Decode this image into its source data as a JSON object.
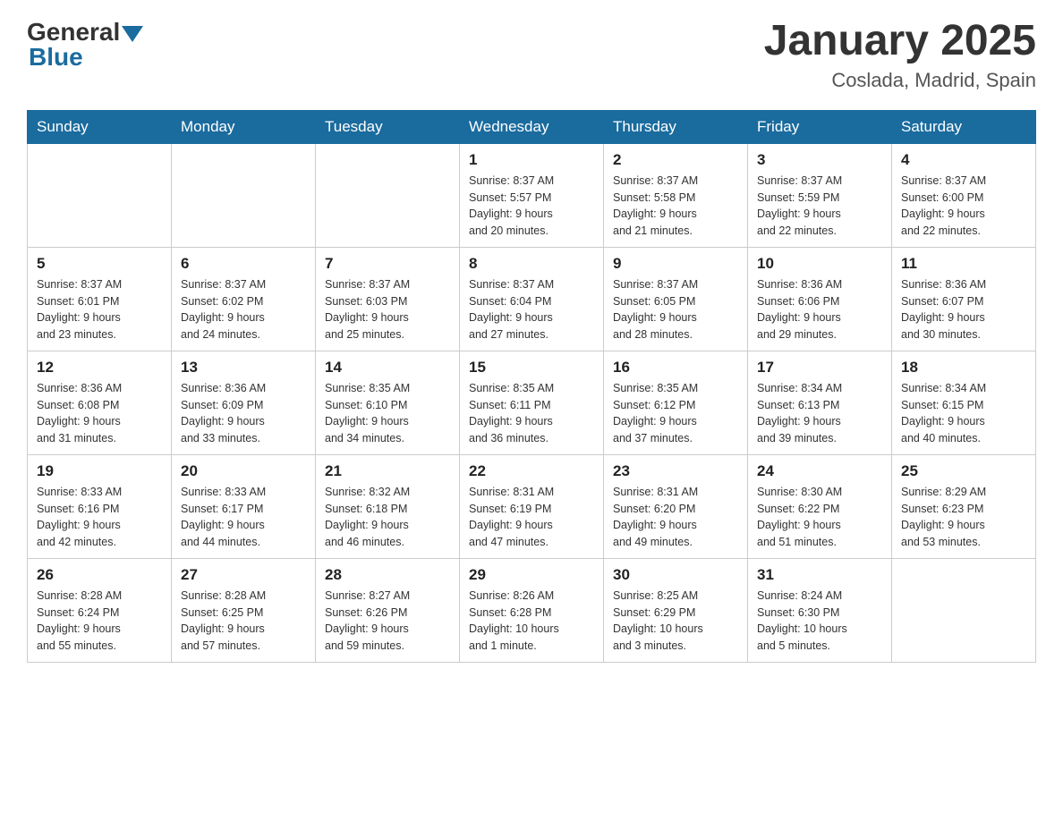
{
  "header": {
    "logo_general": "General",
    "logo_blue": "Blue",
    "month_title": "January 2025",
    "subtitle": "Coslada, Madrid, Spain"
  },
  "days_of_week": [
    "Sunday",
    "Monday",
    "Tuesday",
    "Wednesday",
    "Thursday",
    "Friday",
    "Saturday"
  ],
  "weeks": [
    [
      {
        "day": "",
        "info": ""
      },
      {
        "day": "",
        "info": ""
      },
      {
        "day": "",
        "info": ""
      },
      {
        "day": "1",
        "info": "Sunrise: 8:37 AM\nSunset: 5:57 PM\nDaylight: 9 hours\nand 20 minutes."
      },
      {
        "day": "2",
        "info": "Sunrise: 8:37 AM\nSunset: 5:58 PM\nDaylight: 9 hours\nand 21 minutes."
      },
      {
        "day": "3",
        "info": "Sunrise: 8:37 AM\nSunset: 5:59 PM\nDaylight: 9 hours\nand 22 minutes."
      },
      {
        "day": "4",
        "info": "Sunrise: 8:37 AM\nSunset: 6:00 PM\nDaylight: 9 hours\nand 22 minutes."
      }
    ],
    [
      {
        "day": "5",
        "info": "Sunrise: 8:37 AM\nSunset: 6:01 PM\nDaylight: 9 hours\nand 23 minutes."
      },
      {
        "day": "6",
        "info": "Sunrise: 8:37 AM\nSunset: 6:02 PM\nDaylight: 9 hours\nand 24 minutes."
      },
      {
        "day": "7",
        "info": "Sunrise: 8:37 AM\nSunset: 6:03 PM\nDaylight: 9 hours\nand 25 minutes."
      },
      {
        "day": "8",
        "info": "Sunrise: 8:37 AM\nSunset: 6:04 PM\nDaylight: 9 hours\nand 27 minutes."
      },
      {
        "day": "9",
        "info": "Sunrise: 8:37 AM\nSunset: 6:05 PM\nDaylight: 9 hours\nand 28 minutes."
      },
      {
        "day": "10",
        "info": "Sunrise: 8:36 AM\nSunset: 6:06 PM\nDaylight: 9 hours\nand 29 minutes."
      },
      {
        "day": "11",
        "info": "Sunrise: 8:36 AM\nSunset: 6:07 PM\nDaylight: 9 hours\nand 30 minutes."
      }
    ],
    [
      {
        "day": "12",
        "info": "Sunrise: 8:36 AM\nSunset: 6:08 PM\nDaylight: 9 hours\nand 31 minutes."
      },
      {
        "day": "13",
        "info": "Sunrise: 8:36 AM\nSunset: 6:09 PM\nDaylight: 9 hours\nand 33 minutes."
      },
      {
        "day": "14",
        "info": "Sunrise: 8:35 AM\nSunset: 6:10 PM\nDaylight: 9 hours\nand 34 minutes."
      },
      {
        "day": "15",
        "info": "Sunrise: 8:35 AM\nSunset: 6:11 PM\nDaylight: 9 hours\nand 36 minutes."
      },
      {
        "day": "16",
        "info": "Sunrise: 8:35 AM\nSunset: 6:12 PM\nDaylight: 9 hours\nand 37 minutes."
      },
      {
        "day": "17",
        "info": "Sunrise: 8:34 AM\nSunset: 6:13 PM\nDaylight: 9 hours\nand 39 minutes."
      },
      {
        "day": "18",
        "info": "Sunrise: 8:34 AM\nSunset: 6:15 PM\nDaylight: 9 hours\nand 40 minutes."
      }
    ],
    [
      {
        "day": "19",
        "info": "Sunrise: 8:33 AM\nSunset: 6:16 PM\nDaylight: 9 hours\nand 42 minutes."
      },
      {
        "day": "20",
        "info": "Sunrise: 8:33 AM\nSunset: 6:17 PM\nDaylight: 9 hours\nand 44 minutes."
      },
      {
        "day": "21",
        "info": "Sunrise: 8:32 AM\nSunset: 6:18 PM\nDaylight: 9 hours\nand 46 minutes."
      },
      {
        "day": "22",
        "info": "Sunrise: 8:31 AM\nSunset: 6:19 PM\nDaylight: 9 hours\nand 47 minutes."
      },
      {
        "day": "23",
        "info": "Sunrise: 8:31 AM\nSunset: 6:20 PM\nDaylight: 9 hours\nand 49 minutes."
      },
      {
        "day": "24",
        "info": "Sunrise: 8:30 AM\nSunset: 6:22 PM\nDaylight: 9 hours\nand 51 minutes."
      },
      {
        "day": "25",
        "info": "Sunrise: 8:29 AM\nSunset: 6:23 PM\nDaylight: 9 hours\nand 53 minutes."
      }
    ],
    [
      {
        "day": "26",
        "info": "Sunrise: 8:28 AM\nSunset: 6:24 PM\nDaylight: 9 hours\nand 55 minutes."
      },
      {
        "day": "27",
        "info": "Sunrise: 8:28 AM\nSunset: 6:25 PM\nDaylight: 9 hours\nand 57 minutes."
      },
      {
        "day": "28",
        "info": "Sunrise: 8:27 AM\nSunset: 6:26 PM\nDaylight: 9 hours\nand 59 minutes."
      },
      {
        "day": "29",
        "info": "Sunrise: 8:26 AM\nSunset: 6:28 PM\nDaylight: 10 hours\nand 1 minute."
      },
      {
        "day": "30",
        "info": "Sunrise: 8:25 AM\nSunset: 6:29 PM\nDaylight: 10 hours\nand 3 minutes."
      },
      {
        "day": "31",
        "info": "Sunrise: 8:24 AM\nSunset: 6:30 PM\nDaylight: 10 hours\nand 5 minutes."
      },
      {
        "day": "",
        "info": ""
      }
    ]
  ]
}
